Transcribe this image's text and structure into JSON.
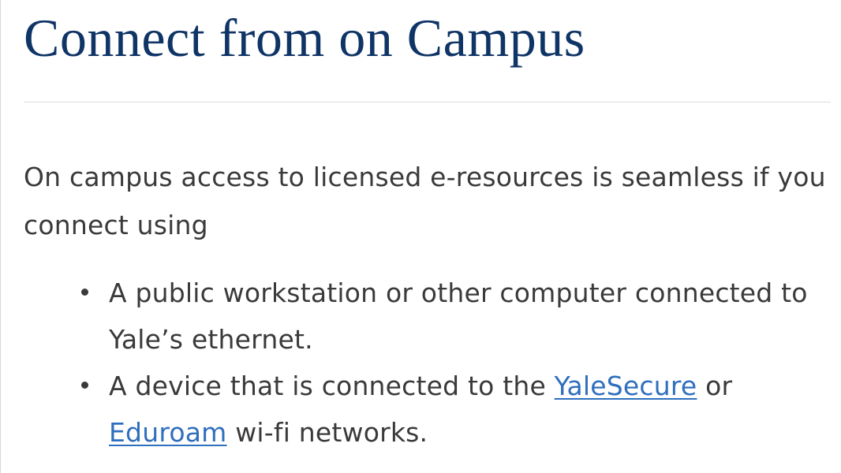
{
  "page": {
    "heading": "Connect from on Campus",
    "intro": "On campus access to licensed e-resources is seamless if you connect using"
  },
  "access_list": {
    "item1": {
      "text": "A public workstation or other computer connected to Yale’s ethernet."
    },
    "item2": {
      "prefix": "A device that is connected to the ",
      "link1": "YaleSecure",
      "middle": " or ",
      "link2": "Eduroam",
      "suffix": " wi-fi networks."
    }
  },
  "colors": {
    "heading": "#0f3466",
    "body_text": "#3a3a3a",
    "link": "#2f6fbd",
    "divider": "#dcdcdc"
  }
}
